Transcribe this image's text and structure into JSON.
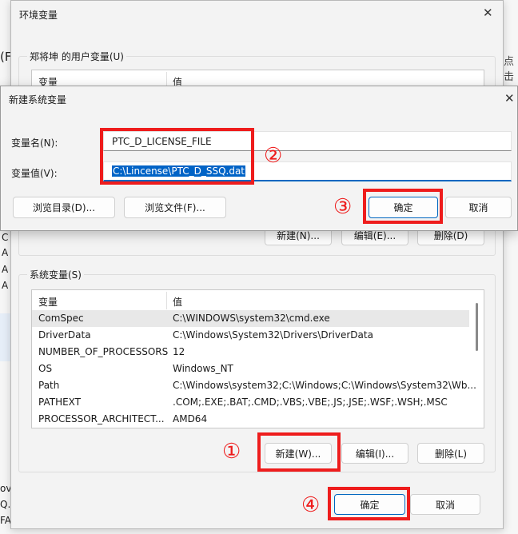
{
  "parent": {
    "title": "环境变量",
    "user_group_label": "郑将坤 的用户变量(U)",
    "user_table": {
      "col_var": "变量",
      "col_val": "值"
    },
    "user_buttons": {
      "new": "新建(N)...",
      "edit": "编辑(E)...",
      "delete": "删除(D)"
    },
    "sys_group_label": "系统变量(S)",
    "sys_table": {
      "col_var": "变量",
      "col_val": "值",
      "rows": [
        {
          "name": "ComSpec",
          "value": "C:\\WINDOWS\\system32\\cmd.exe"
        },
        {
          "name": "DriverData",
          "value": "C:\\Windows\\System32\\Drivers\\DriverData"
        },
        {
          "name": "NUMBER_OF_PROCESSORS",
          "value": "12"
        },
        {
          "name": "OS",
          "value": "Windows_NT"
        },
        {
          "name": "Path",
          "value": "C:\\Windows\\system32;C:\\Windows;C:\\Windows\\System32\\Wb..."
        },
        {
          "name": "PATHEXT",
          "value": ".COM;.EXE;.BAT;.CMD;.VBS;.VBE;.JS;.JSE;.WSF;.WSH;.MSC"
        },
        {
          "name": "PROCESSOR_ARCHITECT...",
          "value": "AMD64"
        }
      ]
    },
    "sys_buttons": {
      "new": "新建(W)...",
      "edit": "编辑(I)...",
      "delete": "删除(L)"
    },
    "ok": "确定",
    "cancel": "取消"
  },
  "dialog": {
    "title": "新建系统变量",
    "name_label": "变量名(N):",
    "value_label": "变量值(V):",
    "name_value": "PTC_D_LICENSE_FILE",
    "value_value": "C:\\Lincense\\PTC_D_SSQ.dat",
    "browse_dir": "浏览目录(D)...",
    "browse_file": "浏览文件(F)...",
    "ok": "确定",
    "cancel": "取消"
  },
  "markers": [
    "①",
    "②",
    "③",
    "④"
  ],
  "background_fragments": {
    "left": [
      "(F",
      "C",
      "A",
      "A",
      "A",
      "ov",
      "Q.d",
      "FA"
    ],
    "right": "点击"
  }
}
